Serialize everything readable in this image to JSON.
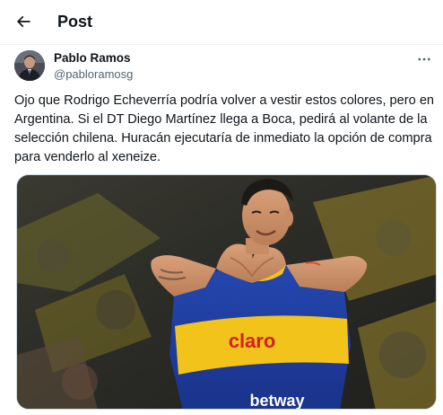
{
  "header": {
    "title": "Post",
    "back_icon": "arrow-left-icon"
  },
  "post": {
    "author": {
      "name": "Pablo Ramos",
      "handle": "@pabloramosg"
    },
    "more_icon": "more-horizontal-icon",
    "text": "Ojo que Rodrigo Echeverría podría volver a vestir estos colores, pero en Argentina. Si el DT Diego Martínez llega a Boca, pedirá al volante de la selección chilena. Huracán ejecutaría de inmediato la opción de compra para venderlo al xeneize.",
    "media": {
      "sponsor_chest": "claro",
      "sponsor_bottom": "betway"
    }
  },
  "colors": {
    "text_primary": "#0f1419",
    "text_secondary": "#536471",
    "jersey_blue": "#1b3fa0",
    "jersey_yellow": "#f2c31b",
    "sponsor_red": "#d6201f"
  }
}
